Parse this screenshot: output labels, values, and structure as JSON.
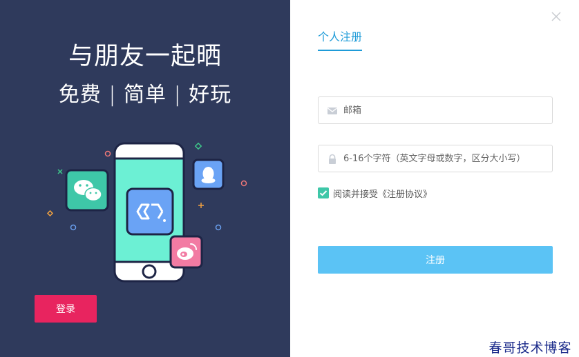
{
  "left": {
    "slogan_title": "与朋友一起晒",
    "slogan_sub": "免费 | 简单 | 好玩",
    "login_label": "登录"
  },
  "right": {
    "tab_label": "个人注册",
    "email_placeholder": "邮箱",
    "password_placeholder": "6-16个字符（英文字母或数字，区分大小写）",
    "agree_text": "阅读并接受《注册协议》",
    "agree_checked": true,
    "register_label": "注册"
  },
  "watermark": "春哥技术博客",
  "colors": {
    "left_bg": "#2f3a5c",
    "login_button": "#e8245f",
    "accent_blue": "#1e9bd8",
    "register_button": "#5bc3f5",
    "checkbox": "#3ec7a8",
    "phone_screen": "#6cf0d4"
  },
  "icons": {
    "close": "close-icon",
    "email": "envelope-icon",
    "password": "lock-icon",
    "checkbox": "checkmark-icon"
  }
}
